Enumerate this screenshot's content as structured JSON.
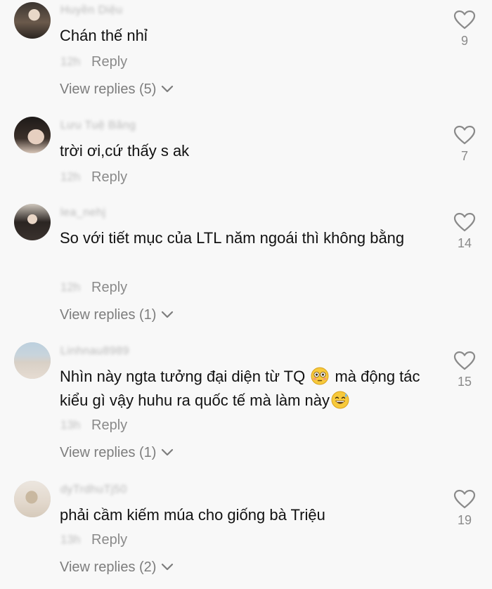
{
  "reply_label": "Reply",
  "colors": {
    "text": "#111111",
    "secondary": "#8a8a8a",
    "background": "#f8f8f8"
  },
  "comments": [
    {
      "username": "Huyền Diệu",
      "text": "Chán thế nhỉ",
      "time": "12h",
      "likes": "9",
      "view_replies": "View replies (5)"
    },
    {
      "username": "Lưu Tuệ Băng",
      "text": "trời ơi,cứ thấy s ak",
      "time": "12h",
      "likes": "7",
      "view_replies": ""
    },
    {
      "username": "lea_nehj",
      "text": "So với tiết mục của LTL năm ngoái thì không bằng",
      "time": "12h",
      "likes": "14",
      "view_replies": "View replies (1)"
    },
    {
      "username": "Linhnau8989",
      "text_part1": "Nhìn này ngta tưởng đại diện từ TQ ",
      "text_part2": " mà động tác kiểu gì vậy huhu ra quốc tế mà làm này",
      "emoji1": "flushed-face-emoji",
      "emoji2": "grinning-sweat-emoji",
      "time": "13h",
      "likes": "15",
      "view_replies": "View replies (1)"
    },
    {
      "username": "dyTrdhuTj50",
      "text": "phải cầm kiếm múa cho giống bà Triệu",
      "time": "13h",
      "likes": "19",
      "view_replies": "View replies (2)"
    }
  ]
}
